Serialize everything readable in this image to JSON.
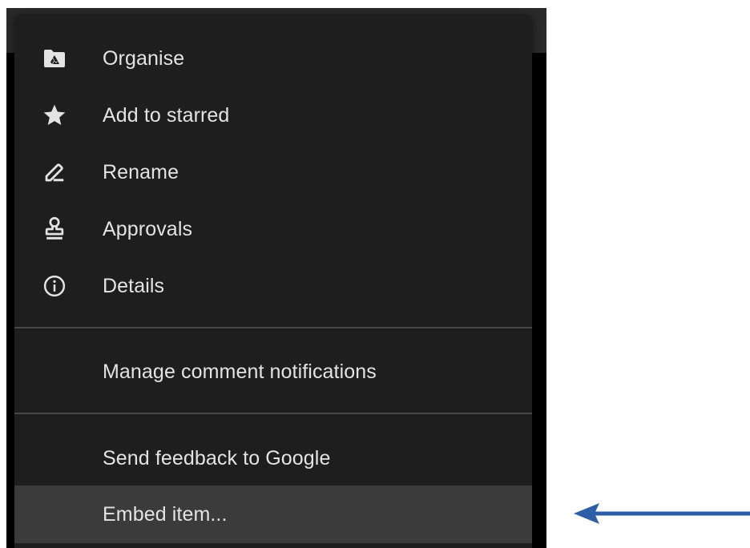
{
  "menu": {
    "items": [
      {
        "label": "Organise",
        "icon": "drive-folder-icon"
      },
      {
        "label": "Add to starred",
        "icon": "star-icon"
      },
      {
        "label": "Rename",
        "icon": "pencil-icon"
      },
      {
        "label": "Approvals",
        "icon": "stamp-icon"
      },
      {
        "label": "Details",
        "icon": "info-icon"
      },
      {
        "label": "Manage comment notifications"
      },
      {
        "label": "Send feedback to Google"
      },
      {
        "label": "Embed item..."
      }
    ]
  },
  "colors": {
    "menu_bg": "#1e1e1f",
    "highlight_bg": "#3b3b3c",
    "text": "#e3e3e3",
    "arrow": "#2f5ea8"
  }
}
